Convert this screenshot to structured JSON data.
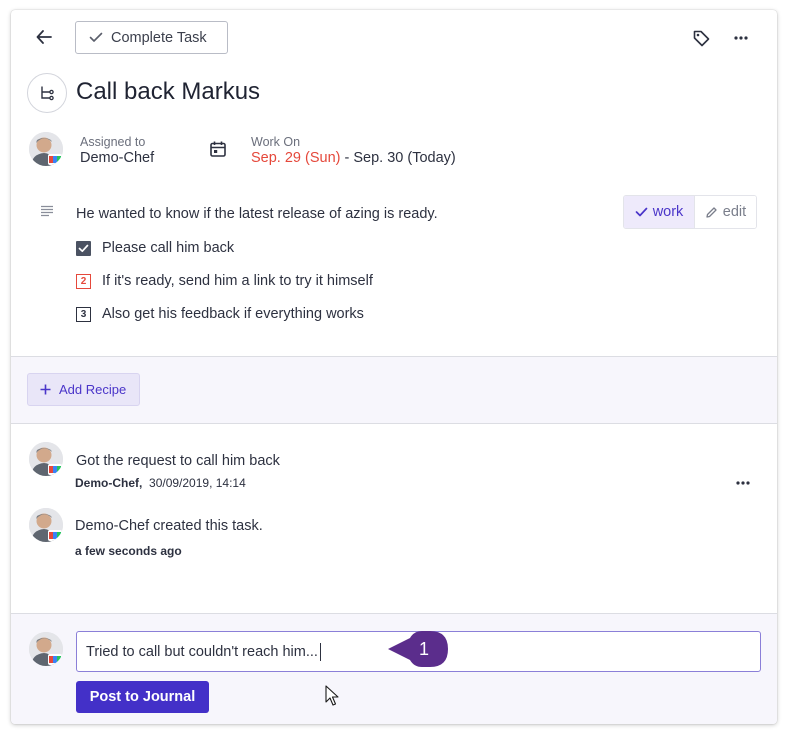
{
  "header": {
    "complete_task_label": "Complete Task",
    "back_icon": "arrow-left-icon",
    "tag_icon": "tag-icon",
    "more_icon": "more-horizontal-icon"
  },
  "task": {
    "title": "Call back Markus",
    "title_icon": "flow-icon",
    "assigned_to_label": "Assigned to",
    "assigned_to_value": "Demo-Chef",
    "work_on_label": "Work On",
    "work_on_start": "Sep. 29 (Sun)",
    "work_on_separator": " - ",
    "work_on_end": "Sep. 30 (Today)"
  },
  "description": {
    "text": "He wanted to know if the latest release of azing is ready.",
    "mode_work_label": "work",
    "mode_edit_label": "edit",
    "checklist": [
      {
        "label": "Please call him back",
        "state": "checked",
        "marker": ""
      },
      {
        "label": "If it's ready, send him a link to try it himself",
        "state": "numbered",
        "marker": "2"
      },
      {
        "label": "Also get his feedback if everything works",
        "state": "numbered",
        "marker": "3"
      }
    ]
  },
  "recipe": {
    "add_recipe_label": "Add Recipe"
  },
  "journal": {
    "entries": [
      {
        "text": "Got the request to call him back",
        "author": "Demo-Chef,",
        "timestamp": "30/09/2019, 14:14"
      },
      {
        "text": "Demo-Chef created this task.",
        "author": "",
        "timestamp": "a few seconds ago"
      }
    ]
  },
  "composer": {
    "value": "Tried to call but couldn't reach him...",
    "post_label": "Post to Journal"
  },
  "annotation": {
    "callout_number": "1"
  },
  "colors": {
    "accent": "#4330c8",
    "date_highlight": "#e5483b",
    "band_background": "#f7f6fc"
  }
}
